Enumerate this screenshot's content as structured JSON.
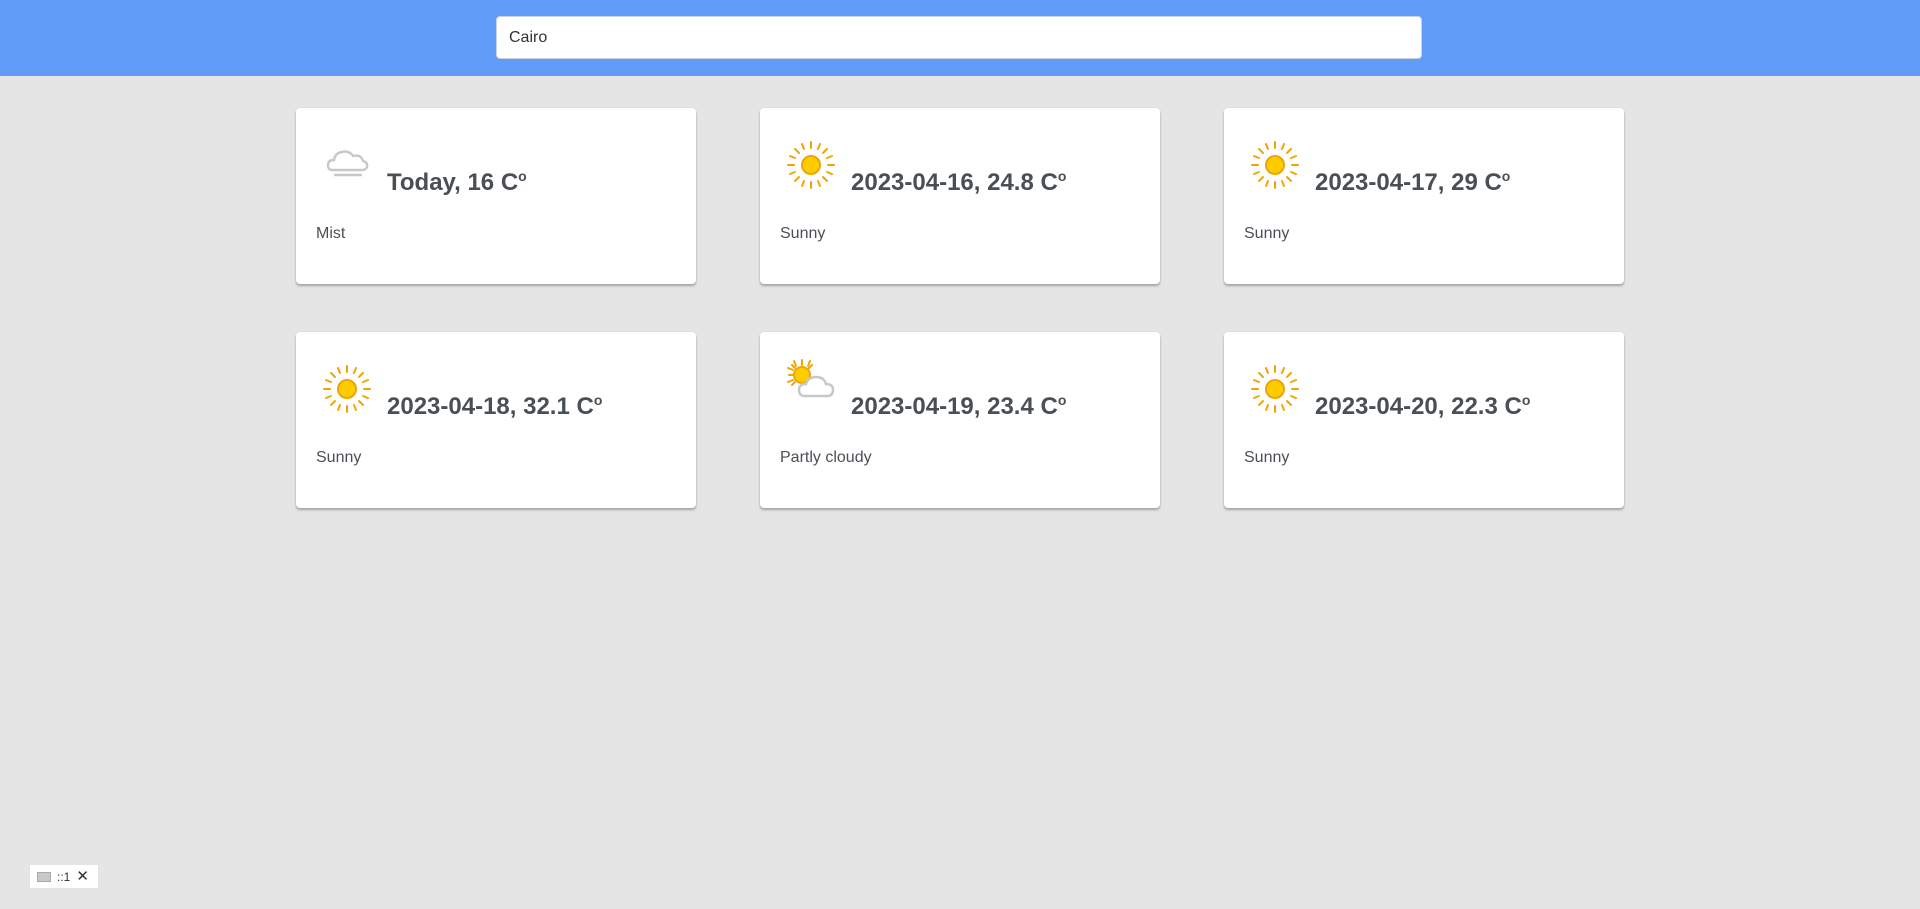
{
  "search": {
    "value": "Cairo",
    "placeholder": ""
  },
  "degree_unit": "C",
  "degree_sign": "o",
  "forecast": [
    {
      "label": "Today, 16 C",
      "condition": "Mist",
      "icon": "mist-icon"
    },
    {
      "label": "2023-04-16, 24.8 C",
      "condition": "Sunny",
      "icon": "sun-icon"
    },
    {
      "label": "2023-04-17, 29 C",
      "condition": "Sunny",
      "icon": "sun-icon"
    },
    {
      "label": "2023-04-18, 32.1 C",
      "condition": "Sunny",
      "icon": "sun-icon"
    },
    {
      "label": "2023-04-19, 23.4 C",
      "condition": "Partly cloudy",
      "icon": "partly-cloudy-icon"
    },
    {
      "label": "2023-04-20, 22.3 C",
      "condition": "Sunny",
      "icon": "sun-icon"
    }
  ],
  "dev_badge": {
    "text": "::1",
    "close_icon": "close-icon"
  },
  "colors": {
    "header": "#5f9bf7",
    "background": "#e5e5e5",
    "sun": "#ffcc00",
    "sun_stroke": "#f0a500",
    "cloud": "#c8c8c8"
  }
}
